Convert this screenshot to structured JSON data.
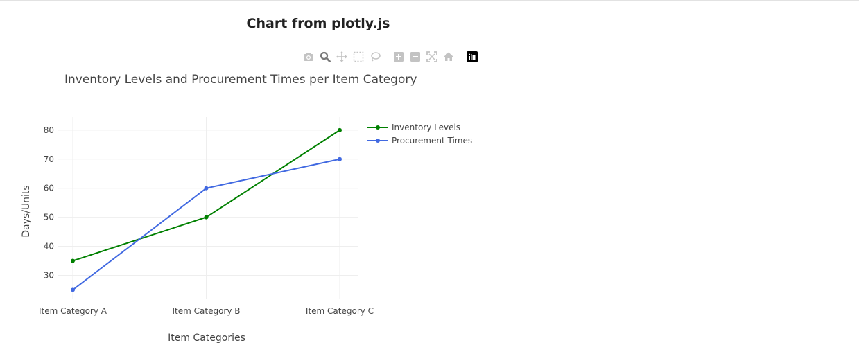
{
  "page": {
    "heading": "Chart from plotly.js"
  },
  "modebar": {
    "buttons": [
      {
        "name": "camera-icon",
        "color": "#c3c3c3"
      },
      {
        "name": "zoom-icon",
        "color": "#7a7a7a"
      },
      {
        "name": "pan-icon",
        "color": "#c3c3c3"
      },
      {
        "name": "box-select-icon",
        "color": "#c3c3c3"
      },
      {
        "name": "lasso-select-icon",
        "color": "#c3c3c3"
      },
      {
        "name": "zoom-in-icon",
        "color": "#c3c3c3"
      },
      {
        "name": "zoom-out-icon",
        "color": "#c3c3c3"
      },
      {
        "name": "autoscale-icon",
        "color": "#c3c3c3"
      },
      {
        "name": "reset-axes-icon",
        "color": "#c3c3c3"
      },
      {
        "name": "plotly-logo-icon",
        "color": "#000000"
      }
    ]
  },
  "chart_data": {
    "type": "line",
    "title": "Inventory Levels and Procurement Times per Item Category",
    "xlabel": "Item Categories",
    "ylabel": "Days/Units",
    "categories": [
      "Item Category A",
      "Item Category B",
      "Item Category C"
    ],
    "series": [
      {
        "name": "Inventory Levels",
        "values": [
          35,
          50,
          80
        ],
        "color": "#008000"
      },
      {
        "name": "Procurement Times",
        "values": [
          25,
          60,
          70
        ],
        "color": "#4169e1"
      }
    ],
    "yticks": [
      "30",
      "40",
      "50",
      "60",
      "70",
      "80"
    ],
    "ylim": [
      22,
      84.5
    ],
    "grid": true,
    "legend_position": "top-right",
    "markers": true
  }
}
